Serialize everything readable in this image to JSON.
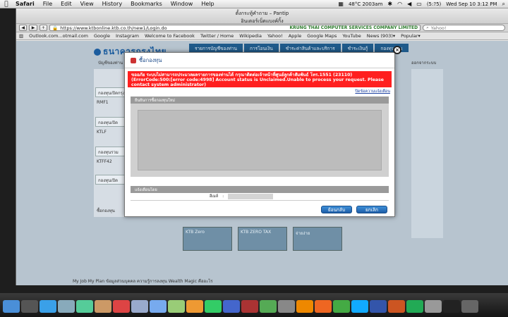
{
  "menubar": {
    "app": "Safari",
    "menus": [
      "File",
      "Edit",
      "View",
      "History",
      "Bookmarks",
      "Window",
      "Help"
    ],
    "battery": "(5:?5)",
    "weather": "48°C\n2003am",
    "clock": "Wed Sep 10  3:12 PM"
  },
  "window": {
    "title": "ตั้งกระทู้คำถาม – Pantip",
    "subtitle": "อินเตอร์เน็ตแบงค์กิ้ง"
  },
  "toolbar": {
    "url": "https://www.ktbonline.ktb.co.th/new1/Login.do",
    "site_identity": "KRUNG THAI COMPUTER SERVICES COMPANY LIMITED",
    "search_placeholder": "Yahoo!"
  },
  "bookmarks": [
    "Outlook.com...otmail.com",
    "Google",
    "Instagram",
    "Welcome to Facebook",
    "Twitter / Home",
    "Wikipedia",
    "Yahoo!",
    "Apple",
    "Google Maps",
    "YouTube",
    "News (903)▾",
    "Popular▾"
  ],
  "page": {
    "logo": "ธนาคารกรุงไทย",
    "nav": [
      "รายการบัญชีของท่าน",
      "การโอนเงิน",
      "ชำระค่าสินค้าและบริการ",
      "ชำระเงินกู้",
      "กองทุนรวม"
    ],
    "left_label": "บัญชีของท่าน",
    "right_label": "ออกจากระบบ",
    "funds": [
      {
        "box": "กองทุนเปิดกรุงไทย",
        "code": "RMF1"
      },
      {
        "box": "กองทุนเปิด",
        "code": "KTLF"
      },
      {
        "box": "กองทุนรวม",
        "code": "KTFF42"
      },
      {
        "box": "กองทุนเปิด",
        "code": ""
      }
    ],
    "fund_buy": "ซื้อกองทุน",
    "banners": [
      "KTB Zero",
      "KTB ZERO TAX",
      "จ่ายง่าย"
    ],
    "footer": "My Job    My Plan    ข้อมูลส่วนบุคคล    ความรู้การลงทุน    Wealth Magic คืออะไร"
  },
  "modal": {
    "title": "ซื้อกองทุน",
    "error": "ขออภัย ระบบไม่สามารถประมวลผลรายการของท่านได้ กรุณาติดต่อเจ้าหน้าที่ศูนย์ลูกค้าสัมพันธ์ โทร.1551 (23110) (ErrorCode:500:[error code:4998] Account status is Unclaimed.Unable to process your request. Please contact system administrator)",
    "help_link": "ปิดข้อความแจ้งเตือน",
    "section1_title": "ยืนยันการซื้อกองทุนใหม่",
    "section2_title": "แจ้งเตือนโดย",
    "field_label": "อีเมล์",
    "field_sep": ":",
    "back_label": "ย้อนกลับ",
    "cancel_label": "ยกเลิก",
    "close_symbol": "×"
  },
  "dock": {
    "icons": [
      "finder-icon",
      "dashboard-icon",
      "safari-icon",
      "mail-icon",
      "ichat-icon",
      "addressbook-icon",
      "ical-icon",
      "preview-icon",
      "itunes-icon",
      "iphoto-icon",
      "pages-icon",
      "numbers-icon",
      "keynote-icon",
      "photobooth-icon",
      "timemachine-icon",
      "systemprefs-icon",
      "vlc-icon",
      "firefox-icon",
      "chrome-icon",
      "skype-icon",
      "word-icon",
      "powerpoint-icon",
      "excel-icon",
      "calculator-icon",
      "terminal-icon",
      "trash-icon"
    ],
    "colors": [
      "#4a8fd8",
      "#555",
      "#3aa0e8",
      "#8ab",
      "#5c9",
      "#c96",
      "#d44",
      "#9ac",
      "#7ae",
      "#9c7",
      "#e93",
      "#3c6",
      "#46c",
      "#a33",
      "#5a5",
      "#888",
      "#e80",
      "#e62",
      "#4a4",
      "#1af",
      "#35a",
      "#c52",
      "#2a5",
      "#999",
      "#222",
      "#666"
    ]
  }
}
